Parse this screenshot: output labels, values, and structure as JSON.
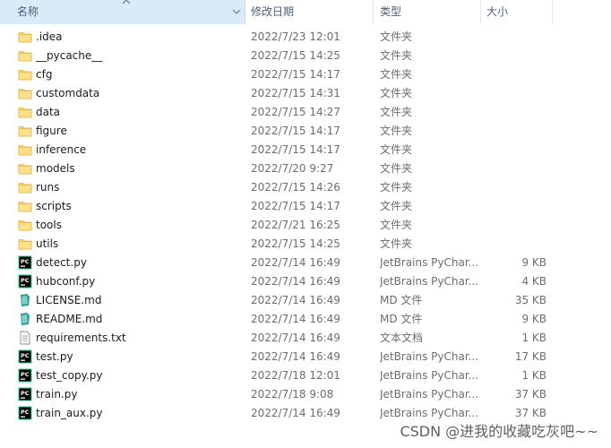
{
  "header": {
    "name": "名称",
    "date": "修改日期",
    "type": "类型",
    "size": "大小"
  },
  "rows": [
    {
      "icon": "folder-icon",
      "name": ".idea",
      "date": "2022/7/23 12:01",
      "type": "文件夹",
      "size": ""
    },
    {
      "icon": "folder-icon",
      "name": "__pycache__",
      "date": "2022/7/15 14:25",
      "type": "文件夹",
      "size": ""
    },
    {
      "icon": "folder-icon",
      "name": "cfg",
      "date": "2022/7/15 14:17",
      "type": "文件夹",
      "size": ""
    },
    {
      "icon": "folder-icon",
      "name": "customdata",
      "date": "2022/7/15 14:31",
      "type": "文件夹",
      "size": ""
    },
    {
      "icon": "folder-icon",
      "name": "data",
      "date": "2022/7/15 14:27",
      "type": "文件夹",
      "size": ""
    },
    {
      "icon": "folder-icon",
      "name": "figure",
      "date": "2022/7/15 14:17",
      "type": "文件夹",
      "size": ""
    },
    {
      "icon": "folder-icon",
      "name": "inference",
      "date": "2022/7/15 14:17",
      "type": "文件夹",
      "size": ""
    },
    {
      "icon": "folder-icon",
      "name": "models",
      "date": "2022/7/20 9:27",
      "type": "文件夹",
      "size": ""
    },
    {
      "icon": "folder-icon",
      "name": "runs",
      "date": "2022/7/15 14:26",
      "type": "文件夹",
      "size": ""
    },
    {
      "icon": "folder-icon",
      "name": "scripts",
      "date": "2022/7/15 14:17",
      "type": "文件夹",
      "size": ""
    },
    {
      "icon": "folder-icon",
      "name": "tools",
      "date": "2022/7/21 16:25",
      "type": "文件夹",
      "size": ""
    },
    {
      "icon": "folder-icon",
      "name": "utils",
      "date": "2022/7/15 14:25",
      "type": "文件夹",
      "size": ""
    },
    {
      "icon": "pycharm-icon",
      "name": "detect.py",
      "date": "2022/7/14 16:49",
      "type": "JetBrains PyChar...",
      "size": "9 KB"
    },
    {
      "icon": "pycharm-icon",
      "name": "hubconf.py",
      "date": "2022/7/14 16:49",
      "type": "JetBrains PyChar...",
      "size": "4 KB"
    },
    {
      "icon": "markdown-icon",
      "name": "LICENSE.md",
      "date": "2022/7/14 16:49",
      "type": "MD 文件",
      "size": "35 KB"
    },
    {
      "icon": "markdown-icon",
      "name": "README.md",
      "date": "2022/7/14 16:49",
      "type": "MD 文件",
      "size": "9 KB"
    },
    {
      "icon": "text-file-icon",
      "name": "requirements.txt",
      "date": "2022/7/14 16:49",
      "type": "文本文档",
      "size": "1 KB"
    },
    {
      "icon": "pycharm-icon",
      "name": "test.py",
      "date": "2022/7/14 16:49",
      "type": "JetBrains PyChar...",
      "size": "17 KB"
    },
    {
      "icon": "pycharm-icon",
      "name": "test_copy.py",
      "date": "2022/7/18 12:01",
      "type": "JetBrains PyChar...",
      "size": "1 KB"
    },
    {
      "icon": "pycharm-icon",
      "name": "train.py",
      "date": "2022/7/18 9:08",
      "type": "JetBrains PyChar...",
      "size": "37 KB"
    },
    {
      "icon": "pycharm-icon",
      "name": "train_aux.py",
      "date": "2022/7/14 16:49",
      "type": "JetBrains PyChar...",
      "size": "37 KB"
    }
  ],
  "watermark": "CSDN @进我的收藏吃灰吧~~"
}
